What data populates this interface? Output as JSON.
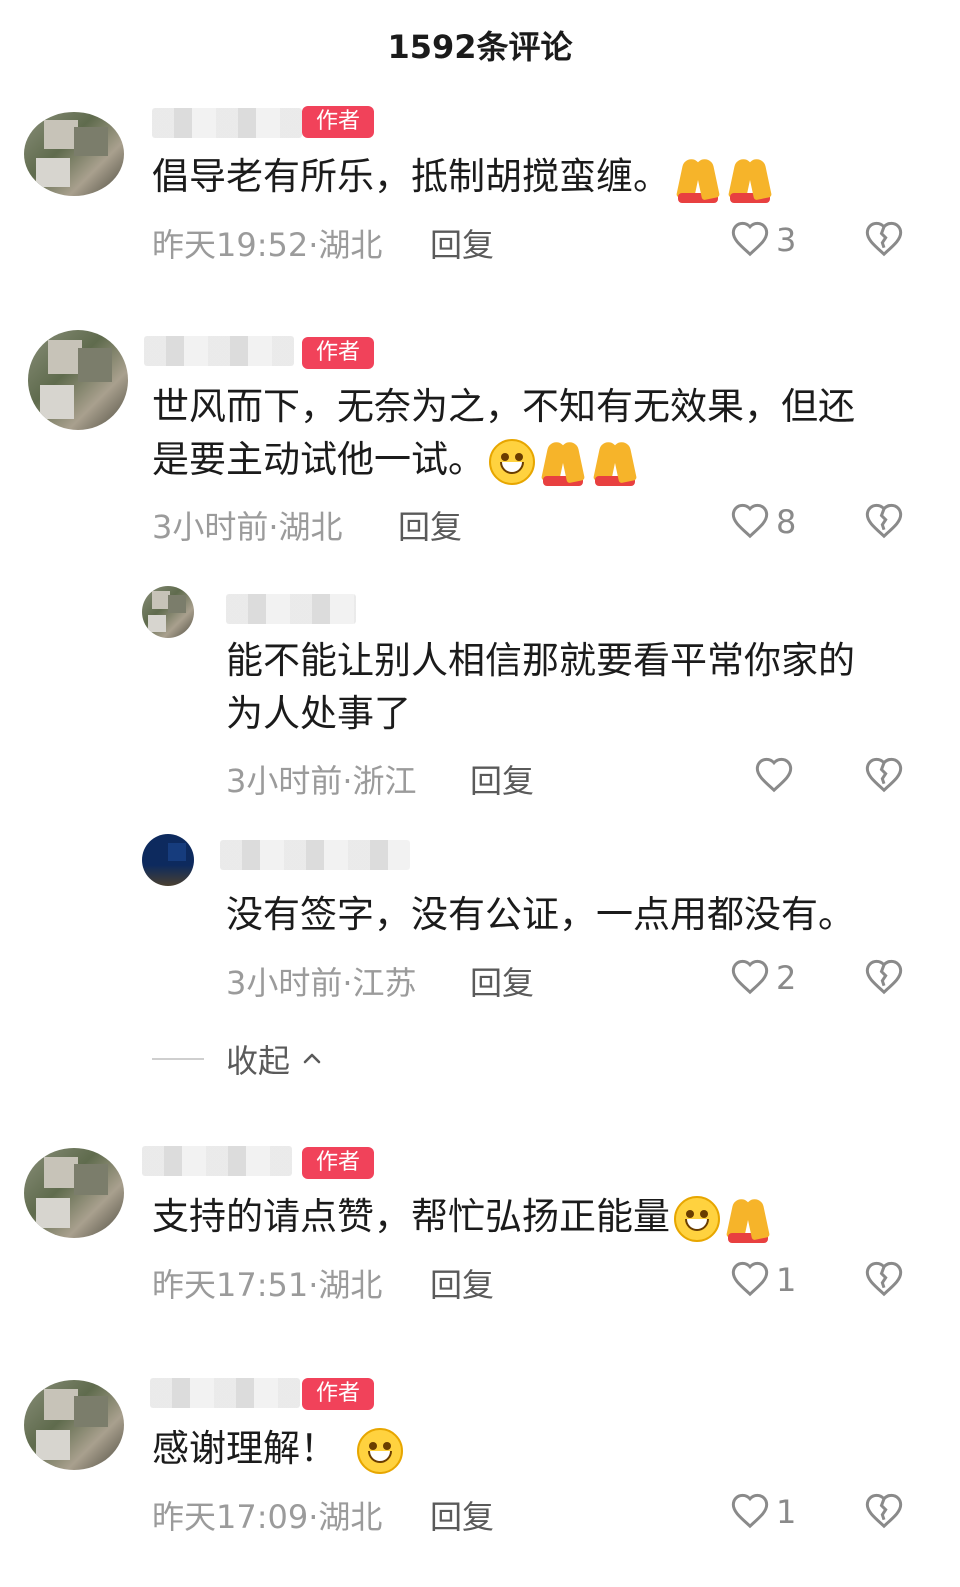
{
  "header": {
    "title": "1592条评论"
  },
  "labels": {
    "author_tag": "作者",
    "reply": "回复",
    "collapse": "收起"
  },
  "comments": [
    {
      "text": "倡导老有所乐，抵制胡搅蛮缠。",
      "emojis": [
        "pray",
        "pray"
      ],
      "meta": "昨天19:52·湖北",
      "likes": "3",
      "is_author": true
    },
    {
      "text": "世风而下，无奈为之，不知有无效果，但还\n是要主动试他一试。",
      "emojis": [
        "smile",
        "pray",
        "pray"
      ],
      "meta": "3小时前·湖北",
      "likes": "8",
      "is_author": true
    },
    {
      "text": "能不能让别人相信那就要看平常你家的\n为人处事了",
      "emojis": [],
      "meta": "3小时前·浙江",
      "likes": "",
      "is_author": false
    },
    {
      "text": "没有签字，没有公证，一点用都没有。",
      "emojis": [],
      "meta": "3小时前·江苏",
      "likes": "2",
      "is_author": false
    },
    {
      "text": "支持的请点赞，帮忙弘扬正能量",
      "emojis": [
        "grin",
        "pray"
      ],
      "meta": "昨天17:51·湖北",
      "likes": "1",
      "is_author": true
    },
    {
      "text": "感谢理解！",
      "emojis": [
        "grin"
      ],
      "meta": "昨天17:09·湖北",
      "likes": "1",
      "is_author": true
    }
  ],
  "colors": {
    "author_tag": "#f1425a",
    "meta_text": "#9b9b9b",
    "icon": "#8a8a8a"
  }
}
